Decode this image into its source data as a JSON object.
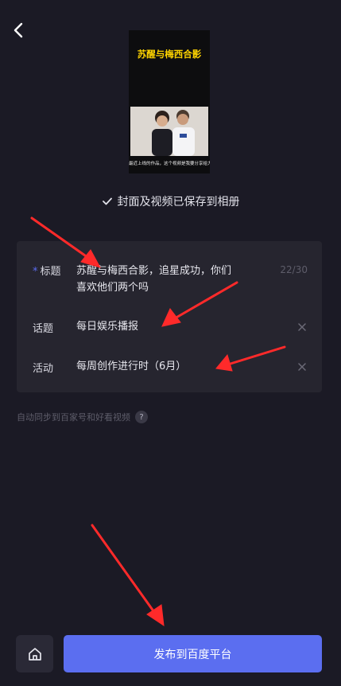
{
  "nav": {
    "back_icon": "chevron-left-icon"
  },
  "cover": {
    "title": "苏醒与梅西合影",
    "caption": "最近上线的作品，这个视频是我要分享给大家的"
  },
  "saved_notice": {
    "icon": "check-icon",
    "text": "封面及视频已保存到相册"
  },
  "form": {
    "title": {
      "required_mark": "*",
      "label": "标题",
      "value_line1": "苏醒与梅西合影，追星成功，你们",
      "value_line2": "喜欢他们两个吗",
      "count": "22/30"
    },
    "topic": {
      "label": "话题",
      "value": "每日娱乐播报",
      "clear_icon": "close-icon"
    },
    "activity": {
      "label": "活动",
      "value": "每周创作进行时（6月）",
      "clear_icon": "close-icon"
    }
  },
  "sync": {
    "text": "自动同步到百家号和好看视频",
    "help": "?"
  },
  "footer": {
    "home_icon": "home-icon",
    "publish_label": "发布到百度平台"
  },
  "colors": {
    "background": "#1b1a25",
    "panel": "#26252f",
    "accent": "#5b6ef0",
    "annotation": "#ff2a2a"
  }
}
